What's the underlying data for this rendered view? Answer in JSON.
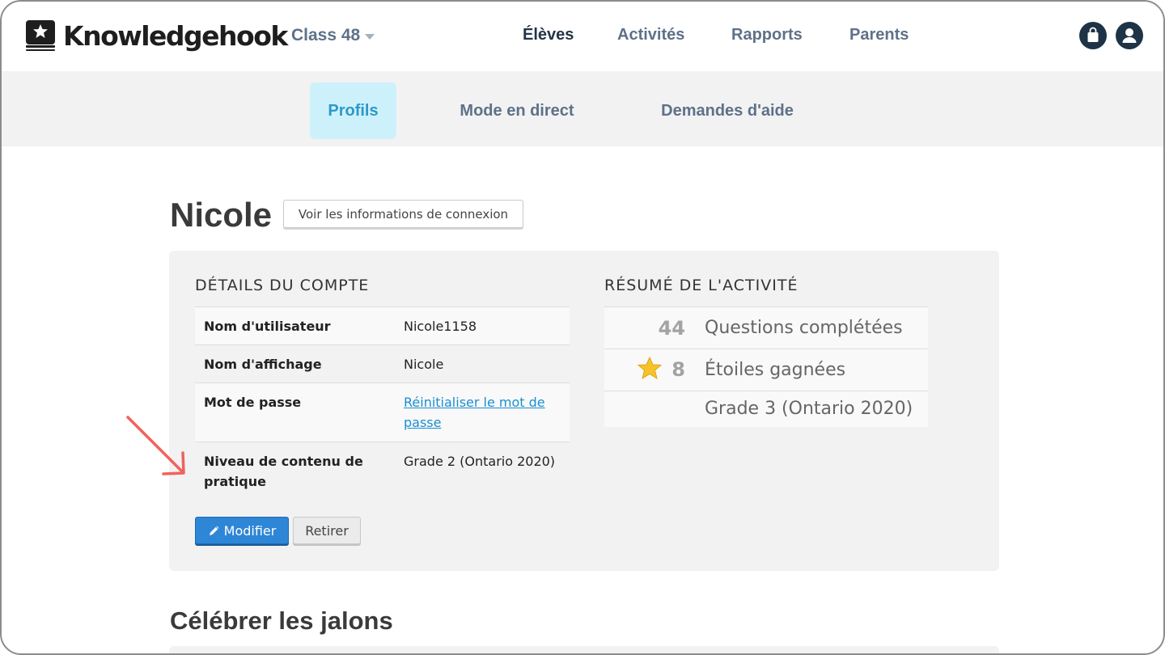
{
  "app": {
    "name": "Knowledgehook"
  },
  "class_selector": {
    "label": "Class 48"
  },
  "main_nav": [
    {
      "label": "Élèves",
      "active": true
    },
    {
      "label": "Activités",
      "active": false
    },
    {
      "label": "Rapports",
      "active": false
    },
    {
      "label": "Parents",
      "active": false
    }
  ],
  "icons": {
    "bag": "shopping-bag-icon",
    "user": "user-profile-icon",
    "logo": "book-star-icon",
    "edit": "pencil-icon",
    "star": "star-icon"
  },
  "sub_tabs": [
    {
      "label": "Profils",
      "active": true
    },
    {
      "label": "Mode en direct",
      "active": false
    },
    {
      "label": "Demandes d'aide",
      "active": false
    }
  ],
  "student": {
    "name": "Nicole",
    "login_info_button": "Voir les informations de connexion"
  },
  "account_details": {
    "title": "DÉTAILS DU COMPTE",
    "rows": [
      {
        "key": "Nom d'utilisateur",
        "value": "Nicole1158"
      },
      {
        "key": "Nom d'affichage",
        "value": "Nicole"
      },
      {
        "key": "Mot de passe",
        "value": "Réinitialiser le mot de passe"
      },
      {
        "key": "Niveau de contenu de pratique",
        "value": "Grade 2 (Ontario 2020)"
      }
    ],
    "edit_button": "Modifier",
    "remove_button": "Retirer"
  },
  "activity_summary": {
    "title": "RÉSUMÉ DE L'ACTIVITÉ",
    "rows": [
      {
        "number": "44",
        "label": "Questions complétées"
      },
      {
        "number": "8",
        "label": "Étoiles gagnées"
      },
      {
        "number": "",
        "label": "Grade 3 (Ontario 2020)"
      }
    ]
  },
  "milestones": {
    "title": "Célébrer les jalons"
  },
  "colors": {
    "accent": "#2d98c7",
    "primary_button": "#2e86d6",
    "nav_dark": "#1f3347",
    "annotation_arrow": "#f0625c",
    "star": "#f5c22a"
  }
}
